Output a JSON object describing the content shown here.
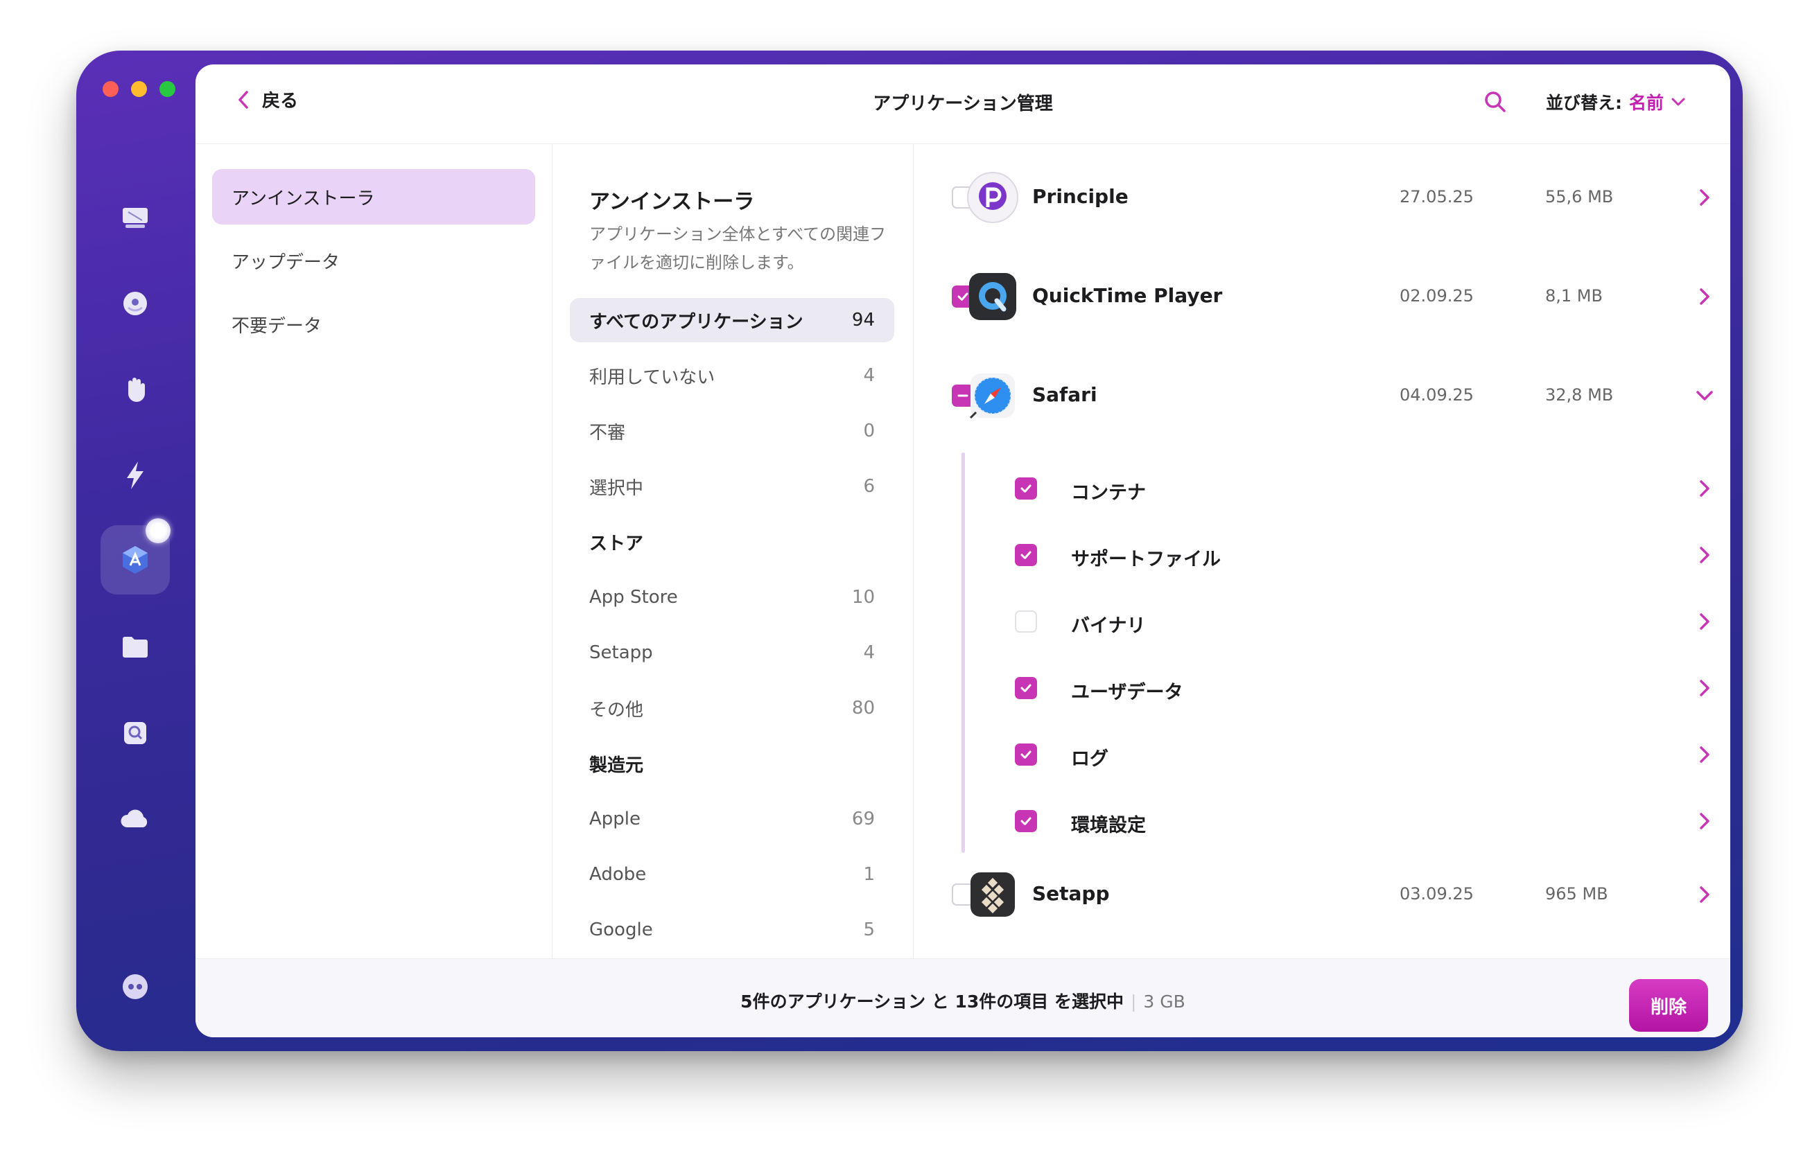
{
  "colors": {
    "accent": "#c735b4",
    "sidebar_active": "#e9d3f6",
    "category_active": "#ebe9f1"
  },
  "header": {
    "back_label": "戻る",
    "title": "アプリケーション管理",
    "sort_label": "並び替え:",
    "sort_value": "名前"
  },
  "sidebar": {
    "items": [
      {
        "label": "アンインストーラ",
        "active": true
      },
      {
        "label": "アップデータ"
      },
      {
        "label": "不要データ"
      }
    ]
  },
  "categories": {
    "heading": "アンインストーラ",
    "description": "アプリケーション全体とすべての関連ファイルを適切に削除します。",
    "items": [
      {
        "label": "すべてのアプリケーション",
        "count": "94",
        "active": true
      },
      {
        "label": "利用していない",
        "count": "4"
      },
      {
        "label": "不審",
        "count": "0"
      },
      {
        "label": "選択中",
        "count": "6"
      },
      {
        "label": "ストア",
        "section": true
      },
      {
        "label": "App Store",
        "count": "10"
      },
      {
        "label": "Setapp",
        "count": "4"
      },
      {
        "label": "その他",
        "count": "80"
      },
      {
        "label": "製造元",
        "section": true
      },
      {
        "label": "Apple",
        "count": "69"
      },
      {
        "label": "Adobe",
        "count": "1"
      },
      {
        "label": "Google",
        "count": "5"
      }
    ]
  },
  "apps": [
    {
      "name": "Principle",
      "date": "27.05.25",
      "size": "55,6 MB",
      "checked": false,
      "icon": "principle-icon"
    },
    {
      "name": "QuickTime Player",
      "date": "02.09.25",
      "size": "8,1 MB",
      "checked": true,
      "icon": "quicktime-icon"
    },
    {
      "name": "Safari",
      "date": "04.09.25",
      "size": "32,8 MB",
      "checked": "mixed",
      "expanded": true,
      "icon": "safari-icon"
    },
    {
      "name": "Setapp",
      "date": "03.09.25",
      "size": "965 MB",
      "checked": false,
      "icon": "setapp-icon"
    }
  ],
  "safari_items": [
    {
      "label": "コンテナ",
      "checked": true
    },
    {
      "label": "サポートファイル",
      "checked": true
    },
    {
      "label": "バイナリ",
      "checked": false
    },
    {
      "label": "ユーザデータ",
      "checked": true
    },
    {
      "label": "ログ",
      "checked": true
    },
    {
      "label": "環境設定",
      "checked": true
    }
  ],
  "footer": {
    "selection_text": "5件のアプリケーション と 13件の項目 を選択中",
    "size": "3 GB",
    "delete_label": "削除"
  }
}
